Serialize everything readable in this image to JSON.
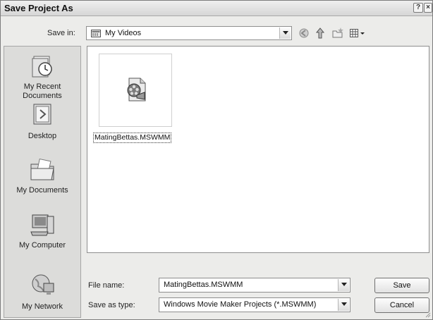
{
  "window": {
    "title": "Save Project As",
    "help_btn": "?",
    "close_btn": "×"
  },
  "toolbar": {
    "save_in_label": "Save in:",
    "save_in_value": "My Videos"
  },
  "places": [
    {
      "label": "My Recent\nDocuments",
      "icon": "recent-documents-icon"
    },
    {
      "label": "Desktop",
      "icon": "desktop-icon"
    },
    {
      "label": "My Documents",
      "icon": "my-documents-icon"
    },
    {
      "label": "My Computer",
      "icon": "my-computer-icon"
    },
    {
      "label": "My Network",
      "icon": "my-network-icon"
    }
  ],
  "files": [
    {
      "name": "MatingBettas.MSWMM",
      "icon": "movie-project-file-icon"
    }
  ],
  "form": {
    "file_name_label": "File name:",
    "file_name_value": "MatingBettas.MSWMM",
    "save_as_type_label": "Save as type:",
    "save_as_type_value": "Windows Movie Maker Projects (*.MSWMM)"
  },
  "buttons": {
    "save": "Save",
    "cancel": "Cancel"
  }
}
